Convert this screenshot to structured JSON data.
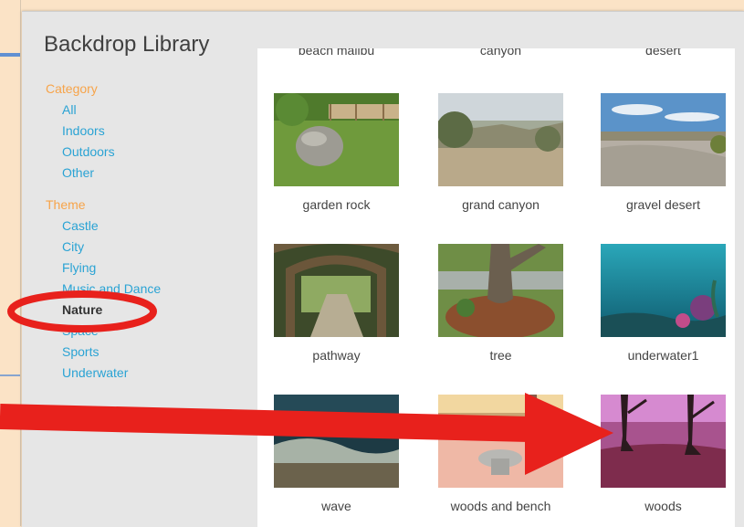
{
  "dialog": {
    "title": "Backdrop Library"
  },
  "sidebar": {
    "category_heading": "Category",
    "categories": [
      "All",
      "Indoors",
      "Outdoors",
      "Other"
    ],
    "theme_heading": "Theme",
    "themes": [
      "Castle",
      "City",
      "Flying",
      "Music and Dance",
      "Nature",
      "Space",
      "Sports",
      "Underwater"
    ],
    "selected": "Nature"
  },
  "library": {
    "cut_row": [
      "beach malibu",
      "canyon",
      "desert"
    ],
    "items": [
      {
        "label": "garden rock"
      },
      {
        "label": "grand canyon"
      },
      {
        "label": "gravel desert"
      },
      {
        "label": "pathway"
      },
      {
        "label": "tree"
      },
      {
        "label": "underwater1"
      },
      {
        "label": "wave"
      },
      {
        "label": "woods and bench"
      },
      {
        "label": "woods"
      }
    ]
  },
  "annotations": {
    "highlight": "circle around selected theme",
    "arrow": "red arrow pointing to woods backdrop",
    "color": "#e8211c"
  }
}
